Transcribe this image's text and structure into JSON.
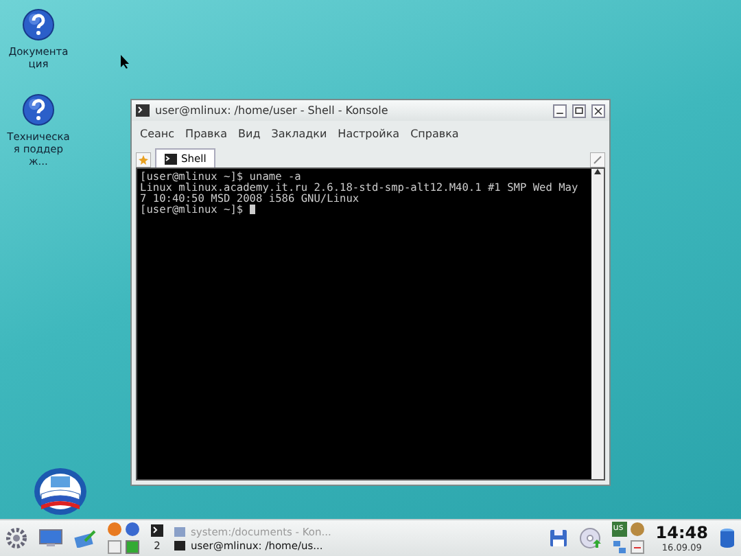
{
  "desktop_icons": [
    {
      "label": "Документация"
    },
    {
      "label": "Техническая поддерж..."
    }
  ],
  "window": {
    "title": "user@mlinux: /home/user - Shell - Konsole",
    "menu": [
      "Сеанс",
      "Правка",
      "Вид",
      "Закладки",
      "Настройка",
      "Справка"
    ],
    "tabs": [
      {
        "label": "Shell",
        "selected": true
      }
    ],
    "terminal_lines": [
      "[user@mlinux ~]$ uname -a",
      "Linux mlinux.academy.it.ru 2.6.18-std-smp-alt12.M40.1 #1 SMP Wed May",
      "7 10:40:50 MSD 2008 i586 GNU/Linux",
      "[user@mlinux ~]$ "
    ]
  },
  "taskbar": {
    "pager": "2",
    "tasks": [
      {
        "label": "system:/documents - Kon...",
        "selected": false
      },
      {
        "label": "user@mlinux: /home/us...",
        "selected": true
      }
    ],
    "keyboard": "us",
    "time": "14:48",
    "date": "16.09.09"
  }
}
